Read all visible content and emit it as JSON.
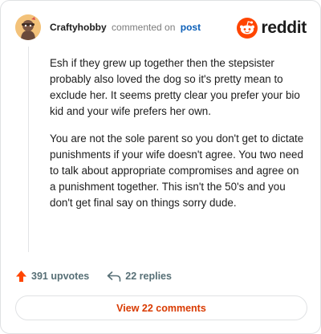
{
  "header": {
    "username": "Craftyhobby",
    "action": "commented on",
    "post_link": "post",
    "logo_icon": "reddit-alien-icon",
    "logo_text": "reddit"
  },
  "comment": {
    "paragraphs": [
      "Esh if they grew up together then the stepsister probably also loved the dog so it's pretty mean to exclude her. It seems pretty clear you prefer your bio kid and your wife prefers her own.",
      "You are not the sole parent so you don't get to dictate punishments if your wife doesn't agree. You two need to talk about appropriate compromises and agree on a punishment together. This isn't the 50's and you don't get final say on things sorry dude."
    ]
  },
  "footer": {
    "upvotes_icon": "upvote-arrow-icon",
    "upvotes": "391 upvotes",
    "replies_icon": "reply-arrow-icon",
    "replies": "22 replies",
    "view_comments": "View 22 comments"
  },
  "colors": {
    "brand": "#ff4500",
    "link": "#0b5fb8",
    "upvote": "#ff4500",
    "button_text": "#d93a00"
  }
}
